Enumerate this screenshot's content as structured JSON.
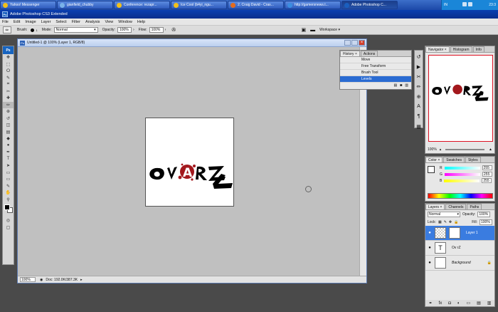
{
  "taskbar": {
    "tasks": [
      {
        "label": "Yahoo! Messenger",
        "color": "#f2c01a",
        "active": false
      },
      {
        "label": "gianfield_chubby",
        "color": "#7ab2e8",
        "active": false
      },
      {
        "label": "Conference: rezapr...",
        "color": "#f2c01a",
        "active": false
      },
      {
        "label": "Ice Cool (b4yi_ngu...",
        "color": "#f2c01a",
        "active": false
      },
      {
        "label": "2. Craig David - Cras...",
        "color": "#e46b1c",
        "active": false
      },
      {
        "label": "http://gamersnews.t...",
        "color": "#3b8de0",
        "active": false
      },
      {
        "label": "Adobe Photoshop C...",
        "color": "#1a5fbf",
        "active": true
      }
    ],
    "tray_lang": "IN",
    "tray_time": "23:3"
  },
  "app": {
    "logo": "Ps",
    "title": "Adobe Photoshop CS3 Extended"
  },
  "menu": [
    "File",
    "Edit",
    "Image",
    "Layer",
    "Select",
    "Filter",
    "Analysis",
    "View",
    "Window",
    "Help"
  ],
  "options": {
    "brush_label": "Brush:",
    "brush_size": "1",
    "mode_label": "Mode:",
    "mode_value": "Normal",
    "opacity_label": "Opacity:",
    "opacity_value": "100%",
    "flow_label": "Flow:",
    "flow_value": "100%",
    "workspace_label": "Workspace ▾"
  },
  "toolbox": {
    "header": "Ps",
    "tools": [
      "move-tool",
      "marquee-tool",
      "lasso-tool",
      "quick-select-tool",
      "crop-tool",
      "slice-tool",
      "healing-tool",
      "brush-tool",
      "stamp-tool",
      "history-brush-tool",
      "eraser-tool",
      "gradient-tool",
      "blur-tool",
      "dodge-tool",
      "pen-tool",
      "type-tool",
      "path-select-tool",
      "shape-tool",
      "notes-tool",
      "eyedropper-tool",
      "hand-tool",
      "zoom-tool"
    ],
    "glyphs": [
      "✥",
      "⬚",
      "ⵔ",
      "✎",
      "⌗",
      "✂",
      "✚",
      "✏",
      "⊕",
      "↺",
      "◫",
      "▤",
      "◆",
      "●",
      "✒",
      "T",
      "➤",
      "▭",
      "▭",
      "✎",
      "✋",
      "⚲"
    ]
  },
  "document": {
    "title": "Untitled-1 @ 100% (Layer 1, RGB/8)",
    "zoom": "100%",
    "status": "Doc: 192.0K/387.3K",
    "logo_main": "OV",
    "logo_a": "A",
    "logo_rz": "RZ"
  },
  "history": {
    "tabs": [
      "History ×",
      "Actions"
    ],
    "items": [
      {
        "label": "Move",
        "selected": false
      },
      {
        "label": "Free Transform",
        "selected": false
      },
      {
        "label": "Brush Tool",
        "selected": false
      },
      {
        "label": "Levels",
        "selected": true
      }
    ]
  },
  "navigator": {
    "tabs": [
      "Navigator ×",
      "Histogram",
      "Info"
    ],
    "zoom": "100%"
  },
  "color": {
    "tabs": [
      "Color ×",
      "Swatches",
      "Styles"
    ],
    "channels": [
      {
        "label": "R",
        "value": "255",
        "gradient": "linear-gradient(90deg,#00ffff,#ffffff)"
      },
      {
        "label": "G",
        "value": "255",
        "gradient": "linear-gradient(90deg,#ff00ff,#ffffff)"
      },
      {
        "label": "B",
        "value": "255",
        "gradient": "linear-gradient(90deg,#ffff00,#ffffff)"
      }
    ]
  },
  "layers": {
    "tabs": [
      "Layers ×",
      "Channels",
      "Paths"
    ],
    "blend_mode": "Normal",
    "opacity_label": "Opacity:",
    "opacity_value": "100%",
    "lock_label": "Lock:",
    "fill_label": "Fill:",
    "fill_value": "100%",
    "items": [
      {
        "name": "Layer 1",
        "selected": true,
        "thumb": "",
        "italic": false
      },
      {
        "name": "Ov rZ",
        "selected": false,
        "thumb": "T",
        "italic": false
      },
      {
        "name": "Background",
        "selected": false,
        "thumb": "",
        "italic": true
      }
    ]
  },
  "colors": {
    "accent": "#2a6bd2",
    "logo_red": "#a3181d"
  }
}
